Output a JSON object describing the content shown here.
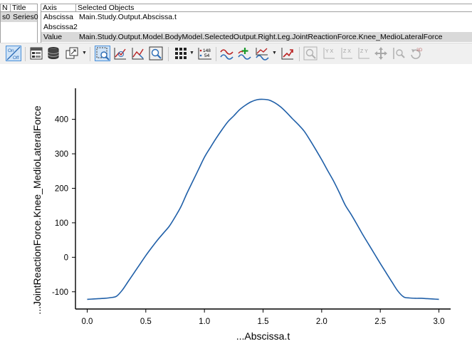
{
  "series_panel": {
    "headers": {
      "n": "N",
      "title": "Title"
    },
    "rows": [
      {
        "n": "s0",
        "title": "Series0"
      }
    ]
  },
  "objects_panel": {
    "headers": {
      "axis": "Axis",
      "selected_objects": "Selected Objects"
    },
    "rows": [
      {
        "axis": "Abscissa",
        "object": "Main.Study.Output.Abscissa.t"
      },
      {
        "axis": "Abscissa2",
        "object": ""
      },
      {
        "axis": "Value",
        "object": "Main.Study.Output.Model.BodyModel.SelectedOutput.Right.Leg.JointReactionForce.Knee_MedioLateralForce"
      }
    ]
  },
  "toolbar": {
    "toggle_on": "On",
    "toggle_off": "Off",
    "data_label_top": "148",
    "data_label_bottom": "54",
    "icons_3d_label": "3D",
    "icon_axis_labels": {
      "yx": "Y X",
      "zx": "Z X",
      "zy": "Z Y"
    }
  },
  "chart_data": {
    "type": "line",
    "title": "",
    "xlabel": "...Abscissa.t",
    "ylabel": "...JointReactionForce.Knee_MedioLateralForce",
    "xlim": [
      -0.1,
      3.1
    ],
    "ylim": [
      -150,
      490
    ],
    "x_ticks": [
      0.0,
      0.5,
      1.0,
      1.5,
      2.0,
      2.5,
      3.0
    ],
    "x_tick_labels": [
      "0.0",
      "0.5",
      "1.0",
      "1.5",
      "2.0",
      "2.5",
      "3.0"
    ],
    "y_ticks": [
      -100,
      0,
      100,
      200,
      300,
      400
    ],
    "y_tick_labels": [
      "-100",
      "0",
      "100",
      "200",
      "300",
      "400"
    ],
    "grid": false,
    "legend": "none",
    "series": [
      {
        "color": "#1f5fa8",
        "x": [
          0.0,
          0.05,
          0.1,
          0.15,
          0.2,
          0.25,
          0.3,
          0.35,
          0.4,
          0.45,
          0.5,
          0.55,
          0.6,
          0.65,
          0.7,
          0.75,
          0.8,
          0.85,
          0.9,
          0.95,
          1.0,
          1.05,
          1.1,
          1.15,
          1.2,
          1.25,
          1.3,
          1.35,
          1.4,
          1.45,
          1.5,
          1.55,
          1.6,
          1.65,
          1.7,
          1.75,
          1.8,
          1.85,
          1.9,
          1.95,
          2.0,
          2.05,
          2.1,
          2.15,
          2.2,
          2.25,
          2.3,
          2.35,
          2.4,
          2.45,
          2.5,
          2.55,
          2.6,
          2.65,
          2.7,
          2.75,
          2.8,
          2.85,
          2.9,
          2.95,
          3.0
        ],
        "y": [
          -122,
          -121,
          -120,
          -119,
          -117,
          -113,
          -95,
          -70,
          -45,
          -20,
          5,
          28,
          50,
          70,
          90,
          117,
          147,
          185,
          220,
          255,
          290,
          318,
          345,
          370,
          393,
          410,
          428,
          441,
          451,
          457,
          458,
          456,
          448,
          436,
          420,
          402,
          385,
          366,
          340,
          312,
          283,
          252,
          222,
          188,
          152,
          125,
          96,
          66,
          38,
          10,
          -18,
          -45,
          -72,
          -98,
          -115,
          -118,
          -119,
          -119,
          -120,
          -121,
          -122
        ]
      }
    ]
  }
}
